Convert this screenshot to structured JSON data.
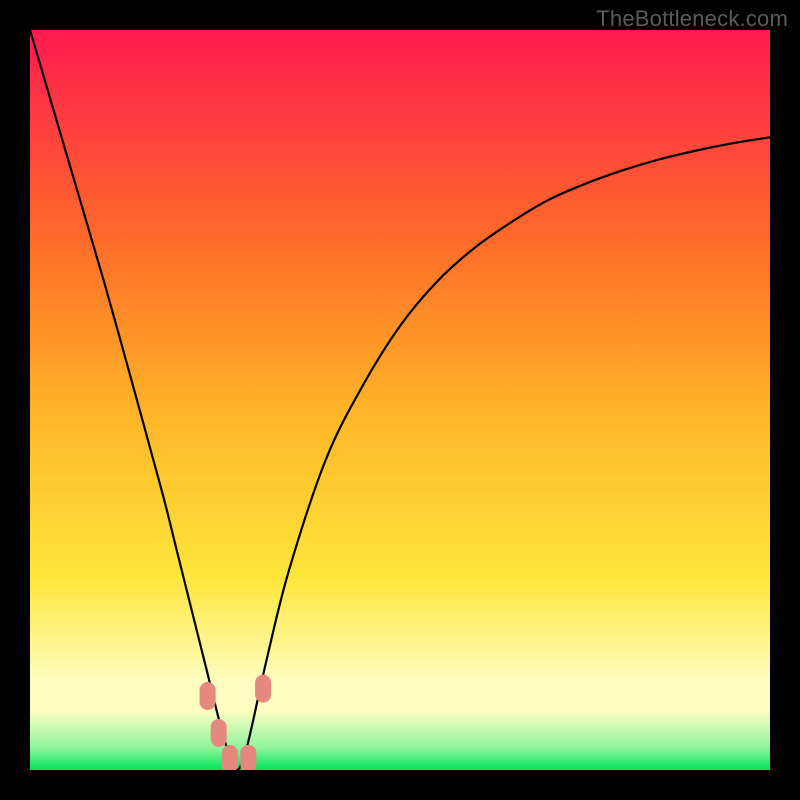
{
  "watermark": "TheBottleneck.com",
  "colors": {
    "background": "#000000",
    "curve": "#000000",
    "markers": "#e5897e",
    "gradient_top": "#ff1a50",
    "gradient_mid1": "#ff6a2a",
    "gradient_mid2": "#ffb627",
    "gradient_mid3": "#ffe63b",
    "gradient_lightband": "#fdfec0",
    "gradient_bottom": "#00e35a"
  },
  "chart_data": {
    "type": "line",
    "title": "",
    "xlabel": "",
    "ylabel": "",
    "xlim": [
      0,
      100
    ],
    "ylim": [
      0,
      100
    ],
    "grid": false,
    "legend_position": "none",
    "series": [
      {
        "name": "bottleneck-curve",
        "x": [
          0,
          5,
          10,
          15,
          18,
          20,
          22,
          24,
          26,
          27,
          28,
          29,
          30,
          32,
          35,
          40,
          45,
          50,
          55,
          60,
          65,
          70,
          75,
          80,
          85,
          90,
          95,
          100
        ],
        "values": [
          100,
          83,
          66,
          48,
          37,
          29,
          21,
          13,
          5,
          2,
          0,
          2,
          6,
          15,
          27,
          42,
          52,
          60,
          66,
          70.5,
          74,
          77,
          79.2,
          81,
          82.5,
          83.7,
          84.7,
          85.5
        ]
      }
    ],
    "annotations": [
      {
        "name": "marker-left-upper",
        "x": 24.0,
        "y": 10.0
      },
      {
        "name": "marker-left-mid",
        "x": 25.5,
        "y": 5.0
      },
      {
        "name": "marker-valley-left",
        "x": 27.0,
        "y": 1.5
      },
      {
        "name": "marker-valley-right",
        "x": 29.5,
        "y": 1.5
      },
      {
        "name": "marker-right-upper",
        "x": 31.5,
        "y": 11.0
      }
    ],
    "optimal_x": 28
  }
}
